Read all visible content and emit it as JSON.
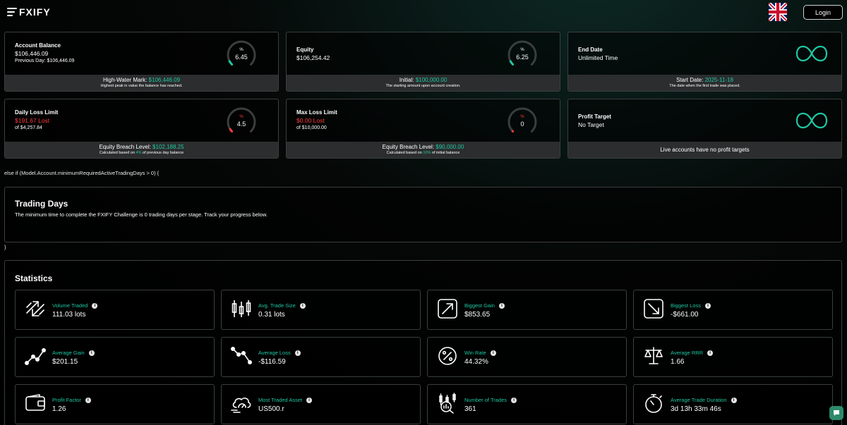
{
  "header": {
    "logo_text": "FXIFY",
    "login_label": "Login",
    "language_flag": "uk-flag-icon"
  },
  "cards": {
    "account_balance": {
      "title": "Account Balance",
      "value": "$106,446.09",
      "previous_day": "Previous Day: $106,446.09",
      "gauge_symbol": "%",
      "gauge_value": "6.45",
      "footer_label": "High-Water Mark: ",
      "footer_value": "$106,446.09",
      "footer_sub": "Highest peak in value the balance has reached."
    },
    "equity": {
      "title": "Equity",
      "value": "$106,254.42",
      "gauge_symbol": "%",
      "gauge_value": "6.25",
      "footer_label": "Initial: ",
      "footer_value": "$100,000.00",
      "footer_sub": "The starting amount upon account creation."
    },
    "end_date": {
      "title": "End Date",
      "value": "Unlimited Time",
      "footer_label": "Start Date: ",
      "footer_value": "2025-11-18",
      "footer_sub": "The date when the first trade was placed."
    },
    "daily_loss": {
      "title": "Daily Loss Limit",
      "lost": "$191.67 Lost",
      "of": "of $4,257.84",
      "gauge_symbol": "%",
      "gauge_value": "4.5",
      "footer_label": "Equity Breach Level: ",
      "footer_value": "$102,188.25",
      "footer_sub_pre": "Calculated based on ",
      "footer_sub_pct": "4%",
      "footer_sub_post": " of previous day balance"
    },
    "max_loss": {
      "title": "Max Loss Limit",
      "lost": "$0.00 Lost",
      "of": "of $10,000.00",
      "gauge_symbol": "%",
      "gauge_value": "0",
      "footer_label": "Equity Breach Level: ",
      "footer_value": "$90,000.00",
      "footer_sub_pre": "Calculated based on ",
      "footer_sub_pct": "10%",
      "footer_sub_post": " of initial balance"
    },
    "profit_target": {
      "title": "Profit Target",
      "value": "No Target",
      "footer": "Live accounts have no profit targets"
    }
  },
  "code_line_1": "else if (Model.Account.minimumRequiredActiveTradingDays > 0) {",
  "code_line_2": "}",
  "trading_days": {
    "title": "Trading Days",
    "text": "The minimum time to complete the FXIFY Challenge is 0 trading days per stage. Track your progress below."
  },
  "statistics": {
    "title": "Statistics",
    "items": [
      {
        "label": "Volume Traded",
        "value": "111.03 lots",
        "icon": "volume-arrows-icon"
      },
      {
        "label": "Avg. Trade Size",
        "value": "0.31 lots",
        "icon": "candlestick-icon"
      },
      {
        "label": "Biggest Gain",
        "value": "$853.65",
        "icon": "arrow-up-right-icon"
      },
      {
        "label": "Biggest Loss",
        "value": "-$661.00",
        "icon": "arrow-down-right-icon"
      },
      {
        "label": "Average Gain",
        "value": "$201.15",
        "icon": "line-up-icon"
      },
      {
        "label": "Average Loss",
        "value": "-$116.59",
        "icon": "line-down-icon"
      },
      {
        "label": "Win Rate",
        "value": "44.32%",
        "icon": "percent-badge-icon"
      },
      {
        "label": "Average RRR",
        "value": "1.66",
        "icon": "scales-icon"
      },
      {
        "label": "Profit Factor",
        "value": "1.26",
        "icon": "wallet-icon"
      },
      {
        "label": "Most Traded Asset",
        "value": "US500.r",
        "icon": "speed-cloud-icon"
      },
      {
        "label": "Number of Trades",
        "value": "361",
        "icon": "trades-magnifier-icon"
      },
      {
        "label": "Average Trade Duration",
        "value": "3d 13h 33m 46s",
        "icon": "stopwatch-icon"
      }
    ]
  },
  "colors": {
    "accent_green": "#1fc7a3",
    "loss_red": "#ff3d3d",
    "footer_gray": "#2b2d2e"
  }
}
